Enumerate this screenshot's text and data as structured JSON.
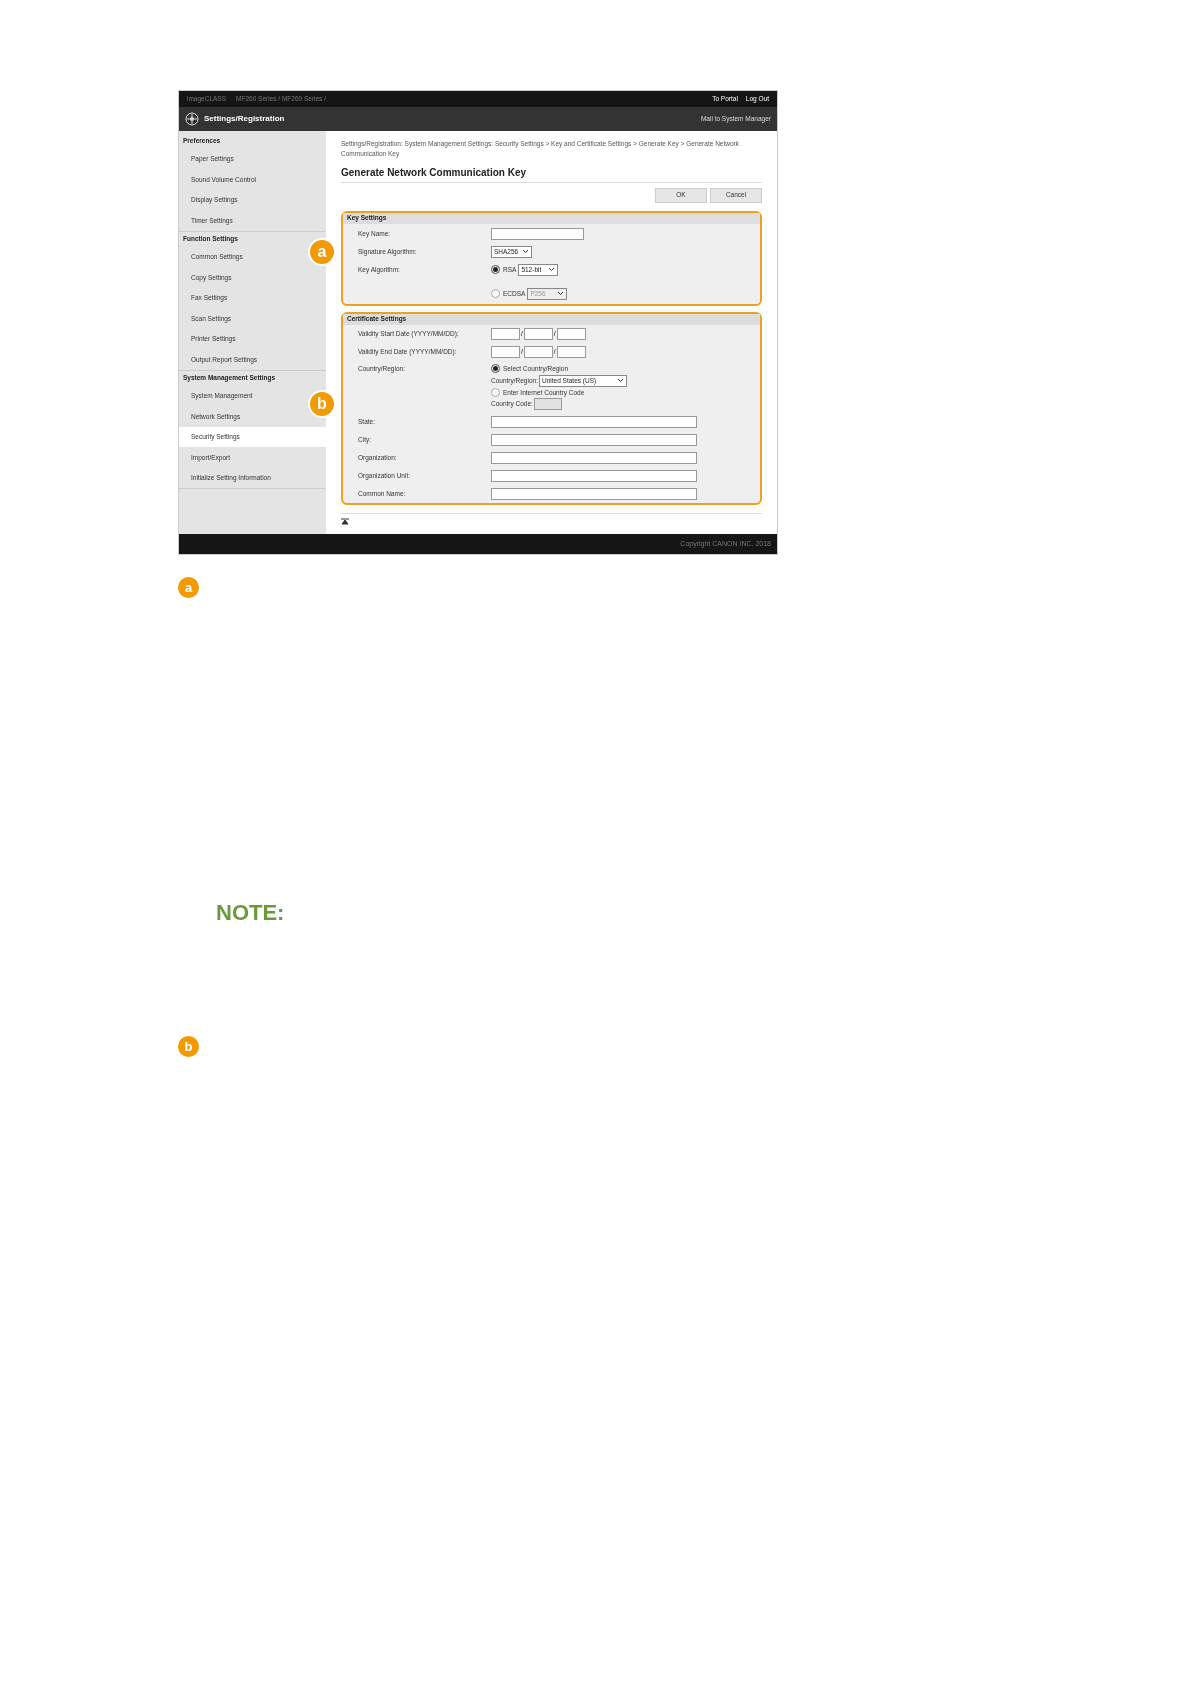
{
  "screenshot": {
    "header": {
      "product": "imageCLASS",
      "path": "MF260 Series / MF260 Series /",
      "links": [
        "To Portal",
        "Log Out"
      ]
    },
    "title_bar": {
      "title": "Settings/Registration",
      "link": "Mail to System Manager"
    },
    "sidebar": {
      "sections": [
        {
          "heading": "Preferences",
          "items": [
            {
              "label": "Paper Settings",
              "selected": false
            },
            {
              "label": "Sound Volume Control",
              "selected": false
            },
            {
              "label": "Display Settings",
              "selected": false
            },
            {
              "label": "Timer Settings",
              "selected": false
            }
          ]
        },
        {
          "heading": "Function Settings",
          "items": [
            {
              "label": "Common Settings",
              "selected": false
            },
            {
              "label": "Copy Settings",
              "selected": false
            },
            {
              "label": "Fax Settings",
              "selected": false
            },
            {
              "label": "Scan Settings",
              "selected": false
            },
            {
              "label": "Printer Settings",
              "selected": false
            },
            {
              "label": "Output Report Settings",
              "selected": false
            }
          ]
        },
        {
          "heading": "System Management Settings",
          "items": [
            {
              "label": "System Management",
              "selected": false
            },
            {
              "label": "Network Settings",
              "selected": false
            },
            {
              "label": "Security Settings",
              "selected": true
            },
            {
              "label": "Import/Export",
              "selected": false
            },
            {
              "label": "Initialize Setting Information",
              "selected": false
            }
          ]
        }
      ]
    },
    "breadcrumb": "Settings/Registration: System Management Settings: Security Settings > Key and Certificate Settings > Generate Key > Generate Network Communication Key",
    "page_title": "Generate Network Communication Key",
    "buttons": [
      "OK",
      "Cancel"
    ],
    "key_settings": {
      "heading": "Key Settings",
      "key_name": {
        "label": "Key Name:"
      },
      "signature_algorithm": {
        "label": "Signature Algorithm:",
        "value": "SHA256"
      },
      "key_algorithm": {
        "label": "Key Algorithm:",
        "options": [
          {
            "label": "RSA",
            "selected": true,
            "value": "512-bit"
          },
          {
            "label": "ECDSA",
            "selected": false,
            "value": "P256"
          }
        ]
      }
    },
    "certificate_settings": {
      "heading": "Certificate Settings",
      "dates": [
        {
          "label": "Validity Start Date (YYYY/MM/DD):",
          "separator": "/"
        },
        {
          "label": "Validity End Date (YYYY/MM/DD):",
          "separator": "/"
        }
      ],
      "country": {
        "label": "Country/Region:",
        "options": [
          {
            "label": "Select Country/Region",
            "selected": true
          },
          {
            "label": "Enter Internet Country Code",
            "selected": false
          }
        ],
        "region_select": {
          "label": "Country/Region:",
          "value": "United States (US)"
        },
        "country_code": {
          "label": "Country Code:",
          "disabled": true
        }
      },
      "text_fields": [
        {
          "label": "State:"
        },
        {
          "label": "City:"
        },
        {
          "label": "Organization:"
        },
        {
          "label": "Organization Unit:"
        },
        {
          "label": "Common Name:"
        }
      ]
    },
    "callouts": [
      "a",
      "b"
    ],
    "footer": "Copyright CANON INC. 2018"
  },
  "markers": [
    "a",
    "b"
  ],
  "note": "NOTE:"
}
